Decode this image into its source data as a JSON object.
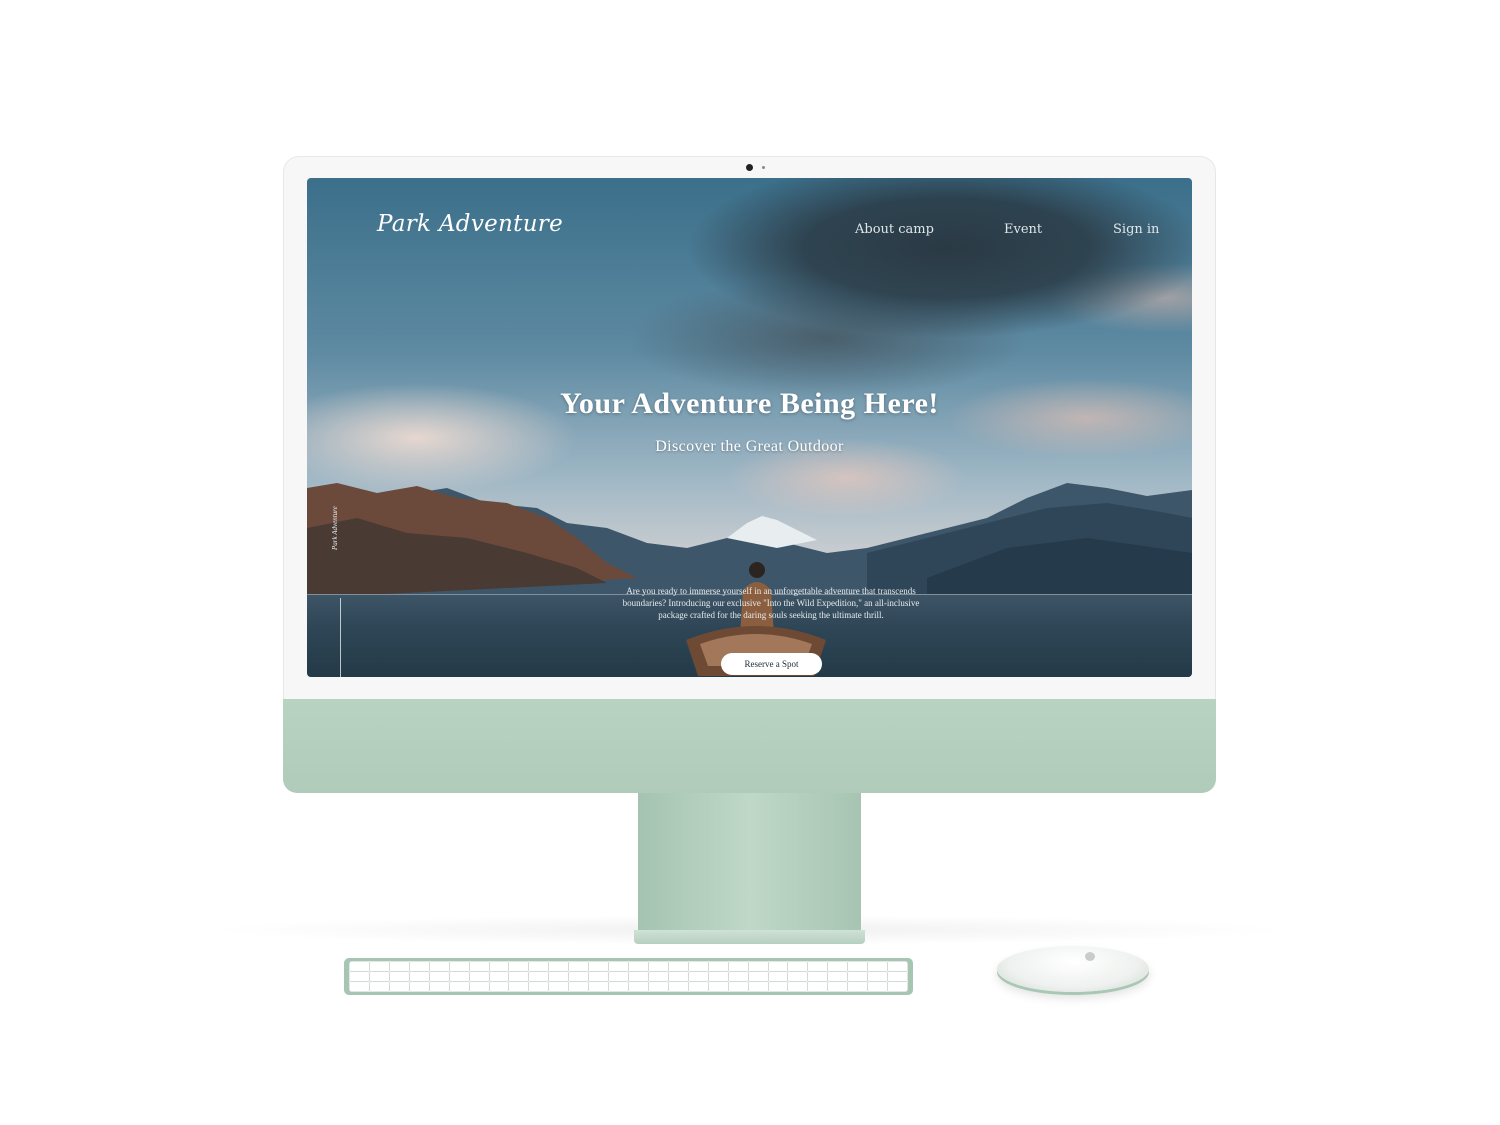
{
  "site": {
    "logo": "Park Adventure",
    "nav": [
      {
        "label": "About camp"
      },
      {
        "label": "Event"
      },
      {
        "label": "Sign in"
      }
    ]
  },
  "hero": {
    "headline": "Your Adventure Being Here!",
    "subheadline": "Discover the Great Outdoor",
    "description": "Are you ready to immerse yourself in an unforgettable adventure that transcends boundaries? Introducing our exclusive \"Into the Wild Expedition,\" an all-inclusive package crafted for the daring souls seeking the ultimate thrill.",
    "cta_label": "Reserve a Spot",
    "vertical_label": "Park Adventure"
  },
  "colors": {
    "device_accent": "#b5cfbf",
    "cta_background": "#ffffff",
    "text_light": "#ffffff"
  }
}
